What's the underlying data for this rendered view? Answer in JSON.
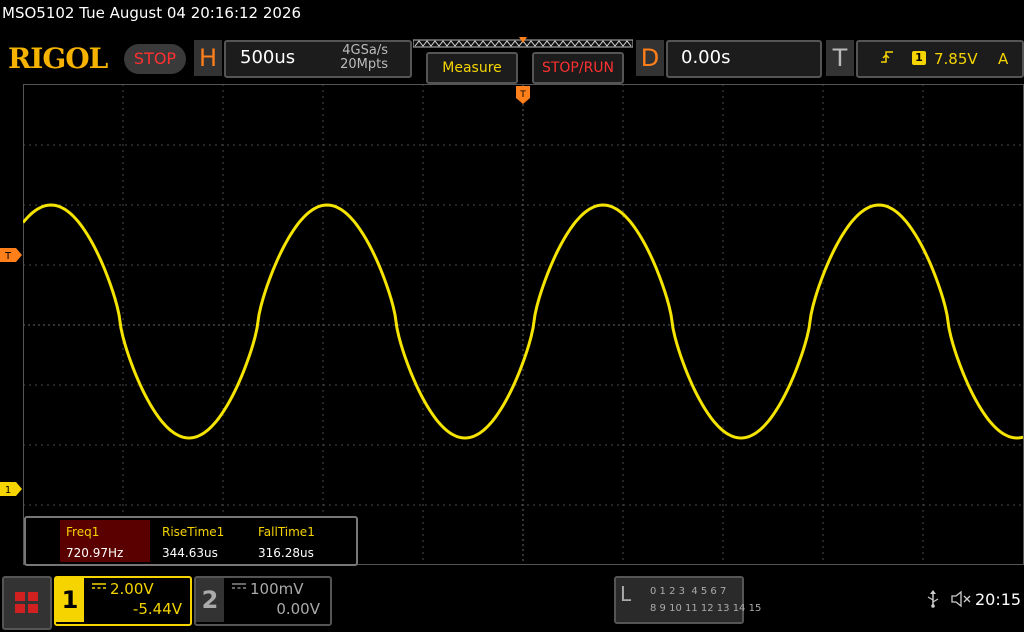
{
  "title_bar": "MSO5102  Tue August 04 20:16:12 2026",
  "header": {
    "logo": "RIGOL",
    "status": "STOP",
    "horizontal": {
      "letter": "H",
      "timebase": "500us",
      "sample_rate": "4GSa/s",
      "memory_depth": "20Mpts"
    },
    "measure_label": "Measure",
    "stop_run_label": "STOP/RUN",
    "delay": {
      "letter": "D",
      "value": "0.00s"
    },
    "trigger": {
      "letter": "T",
      "slope_icon": "rising-edge-icon",
      "source": "1",
      "level": "7.85V",
      "mode": "A"
    }
  },
  "markers": {
    "ch1": "1",
    "trigger_level": "T"
  },
  "measurements": [
    {
      "name": "Freq1",
      "value": "720.97Hz"
    },
    {
      "name": "RiseTime1",
      "value": "344.63us"
    },
    {
      "name": "FallTime1",
      "value": "316.28us"
    }
  ],
  "channels": [
    {
      "num": "1",
      "scale": "2.00V",
      "offset": "-5.44V",
      "active": true
    },
    {
      "num": "2",
      "scale": "100mV",
      "offset": "0.00V",
      "active": false
    }
  ],
  "logic": {
    "letter": "L",
    "row1": "0 1 2 3  4 5 6 7",
    "row2": "8 9 10 11 12 13 14 15"
  },
  "status_bar": {
    "clock": "20:15"
  },
  "colors": {
    "ch1": "#f5d400",
    "accent": "#ff7f1a",
    "stop": "#ff3030"
  }
}
